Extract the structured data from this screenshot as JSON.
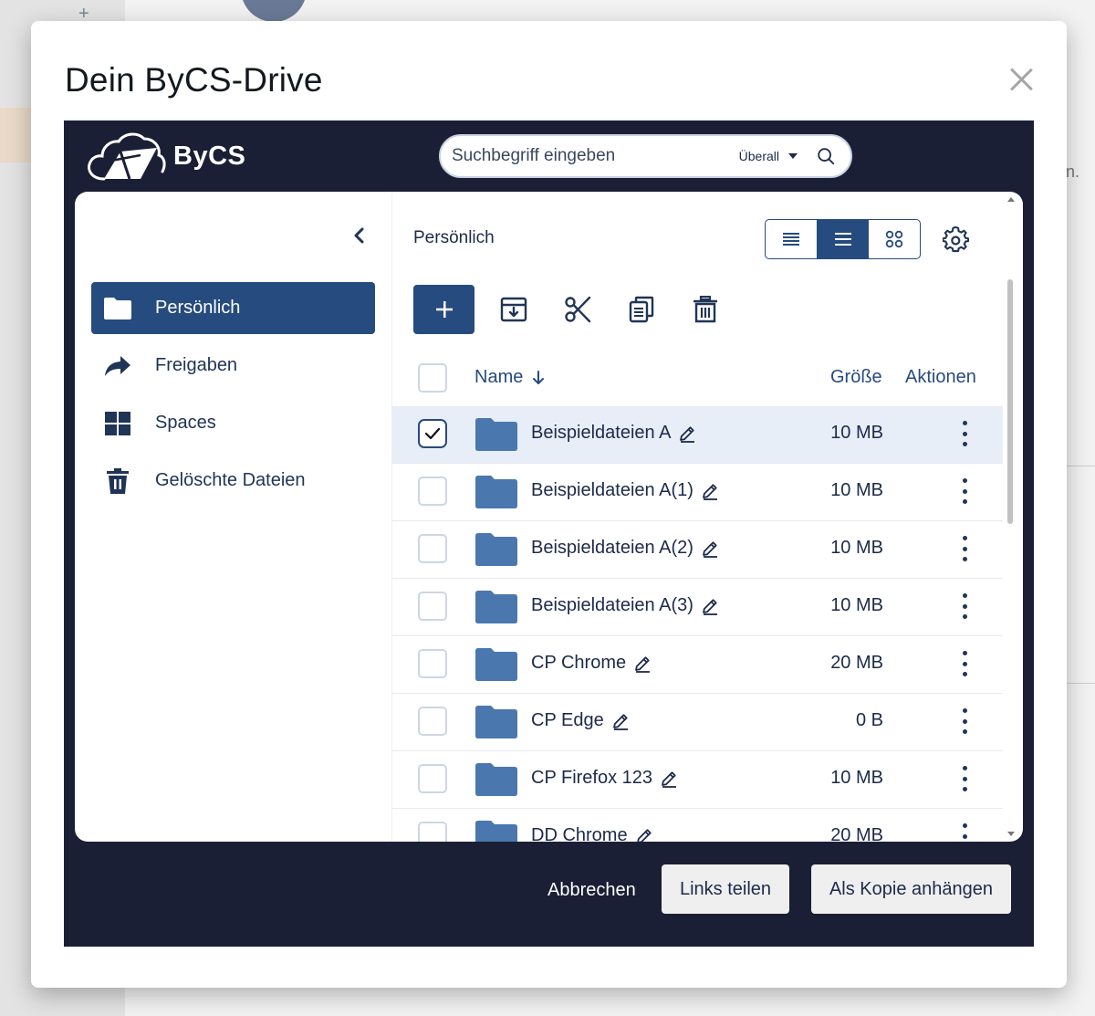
{
  "dialog": {
    "title": "Dein ByCS-Drive"
  },
  "header": {
    "logo_text": "ByCS",
    "search_placeholder": "Suchbegriff eingeben",
    "search_scope": "Überall"
  },
  "sidebar": {
    "items": [
      {
        "label": "Persönlich",
        "icon": "folder-icon",
        "active": true
      },
      {
        "label": "Freigaben",
        "icon": "share-arrow-icon",
        "active": false
      },
      {
        "label": "Spaces",
        "icon": "grid-icon",
        "active": false
      },
      {
        "label": "Gelöschte Dateien",
        "icon": "trash-icon",
        "active": false
      }
    ]
  },
  "content": {
    "breadcrumb": "Persönlich",
    "table": {
      "col_name": "Name",
      "col_size": "Größe",
      "col_actions": "Aktionen",
      "rows": [
        {
          "name": "Beispieldateien A",
          "size": "10 MB",
          "selected": true
        },
        {
          "name": "Beispieldateien A(1)",
          "size": "10 MB",
          "selected": false
        },
        {
          "name": "Beispieldateien A(2)",
          "size": "10 MB",
          "selected": false
        },
        {
          "name": "Beispieldateien A(3)",
          "size": "10 MB",
          "selected": false
        },
        {
          "name": "CP Chrome",
          "size": "20 MB",
          "selected": false
        },
        {
          "name": "CP Edge",
          "size": "0 B",
          "selected": false
        },
        {
          "name": "CP Firefox 123",
          "size": "10 MB",
          "selected": false
        },
        {
          "name": "DD Chrome",
          "size": "20 MB",
          "selected": false
        }
      ]
    }
  },
  "footer": {
    "cancel_label": "Abbrechen",
    "share_links_label": "Links teilen",
    "attach_copy_label": "Als Kopie anhängen"
  },
  "colors": {
    "frame_bg": "#1b1f35",
    "accent": "#264b7f",
    "folder": "#4a78ae",
    "selected_row": "#e8eef7"
  }
}
